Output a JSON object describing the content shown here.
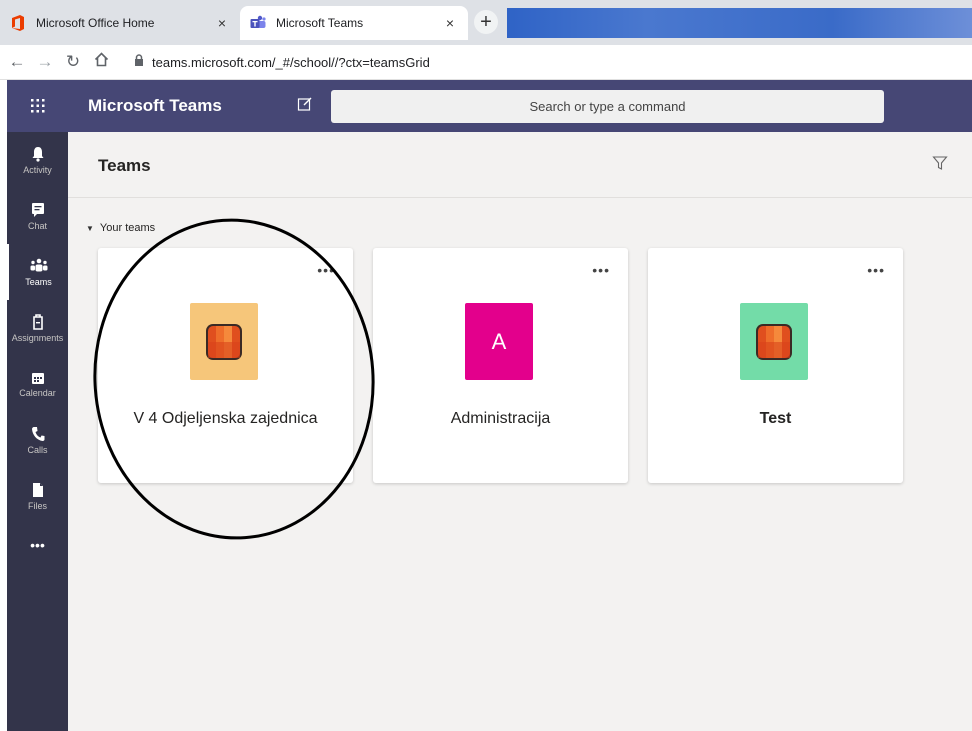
{
  "browser": {
    "tabs": [
      {
        "title": "Microsoft Office Home",
        "close": "×"
      },
      {
        "title": "Microsoft Teams",
        "close": "×"
      }
    ],
    "new_tab": "+",
    "url": "teams.microsoft.com/_#/school//?ctx=teamsGrid"
  },
  "teams": {
    "app_name": "Microsoft Teams",
    "search_placeholder": "Search or type a command",
    "rail": [
      {
        "label": "Activity"
      },
      {
        "label": "Chat"
      },
      {
        "label": "Teams"
      },
      {
        "label": "Assignments"
      },
      {
        "label": "Calendar"
      },
      {
        "label": "Calls"
      },
      {
        "label": "Files"
      }
    ],
    "rail_more": "•••",
    "page_title": "Teams",
    "section_label": "Your teams",
    "cards": [
      {
        "name": "V 4 Odjeljenska zajednica",
        "avatar_color": "#f6c67a",
        "more": "•••"
      },
      {
        "name": "Administracija",
        "avatar_letter": "A",
        "avatar_color": "#e3008c",
        "more": "•••"
      },
      {
        "name": "Test",
        "avatar_color": "#73dca8",
        "more": "•••"
      }
    ]
  },
  "colors": {
    "header": "#464775",
    "rail": "#33344a",
    "accent": "#e3008c"
  }
}
